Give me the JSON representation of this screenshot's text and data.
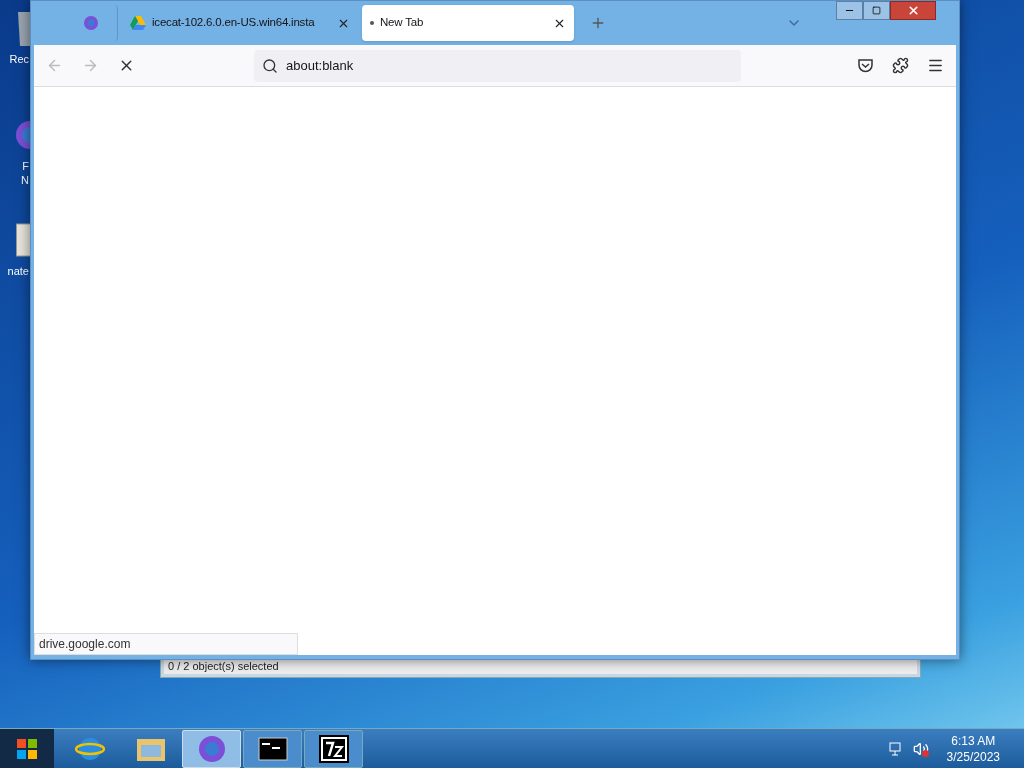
{
  "desktop_icons": [
    {
      "kind": "recycle",
      "label": "Rec"
    },
    {
      "kind": "browser",
      "label": "F\nN"
    },
    {
      "kind": "file",
      "label": "nate"
    }
  ],
  "background_window": {
    "status": "0 / 2 object(s) selected"
  },
  "browser": {
    "tabs": [
      {
        "kind": "pinned",
        "selected": false
      },
      {
        "kind": "drive",
        "title": "icecat-102.6.0.en-US.win64.insta",
        "selected": false
      },
      {
        "kind": "loading",
        "title": "New Tab",
        "selected": true
      }
    ],
    "address": "about:blank",
    "loading": true,
    "status_text": "drive.google.com"
  },
  "taskbar": {
    "items": [
      {
        "kind": "ie",
        "selected": false
      },
      {
        "kind": "explorer",
        "selected": false
      },
      {
        "kind": "firefox",
        "selected": true
      },
      {
        "kind": "cmd",
        "selected": false
      },
      {
        "kind": "archive",
        "selected": false
      }
    ],
    "time": "6:13 AM",
    "date": "3/25/2023"
  }
}
